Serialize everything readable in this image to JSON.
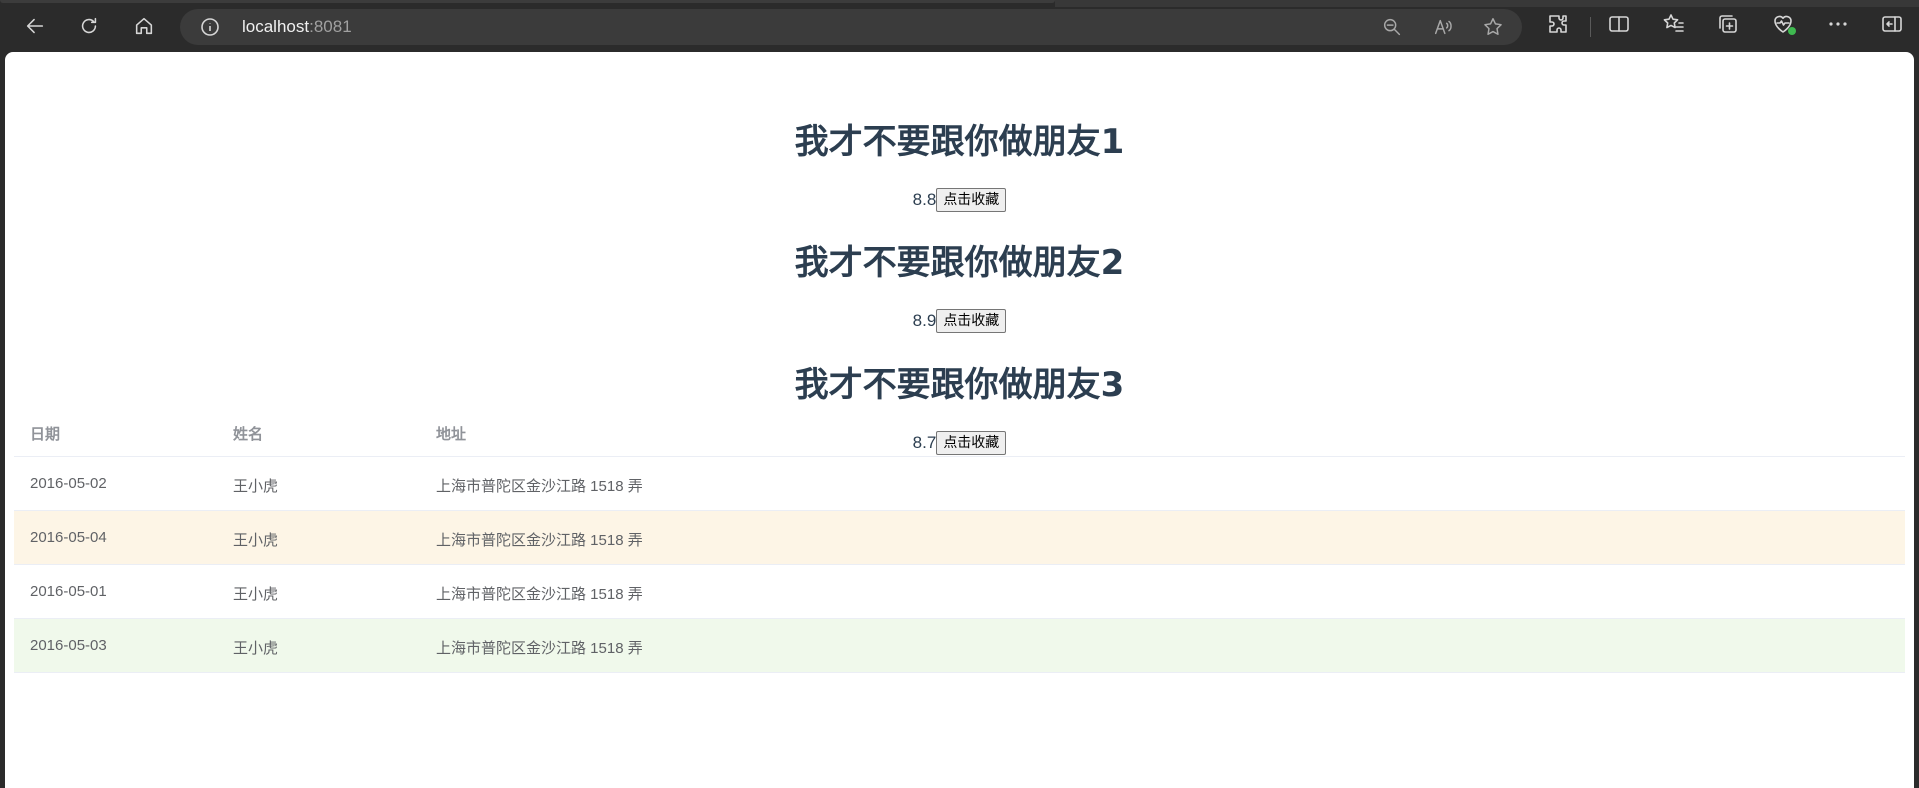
{
  "browser": {
    "url_host": "localhost",
    "url_port": ":8081"
  },
  "movies": [
    {
      "title": "我才不要跟你做朋友1",
      "rating": "8.8",
      "button_label": "点击收藏"
    },
    {
      "title": "我才不要跟你做朋友2",
      "rating": "8.9",
      "button_label": "点击收藏"
    },
    {
      "title": "我才不要跟你做朋友3",
      "rating": "8.7",
      "button_label": "点击收藏"
    }
  ],
  "table": {
    "headers": [
      "日期",
      "姓名",
      "地址"
    ],
    "rows": [
      {
        "date": "2016-05-02",
        "name": "王小虎",
        "address": "上海市普陀区金沙江路 1518 弄",
        "status": "normal"
      },
      {
        "date": "2016-05-04",
        "name": "王小虎",
        "address": "上海市普陀区金沙江路 1518 弄",
        "status": "warning"
      },
      {
        "date": "2016-05-01",
        "name": "王小虎",
        "address": "上海市普陀区金沙江路 1518 弄",
        "status": "normal"
      },
      {
        "date": "2016-05-03",
        "name": "王小虎",
        "address": "上海市普陀区金沙江路 1518 弄",
        "status": "success"
      }
    ]
  },
  "colors": {
    "heading": "#2c3e50",
    "warning_row": "#fdf5e6",
    "success_row": "#f0f9eb"
  }
}
